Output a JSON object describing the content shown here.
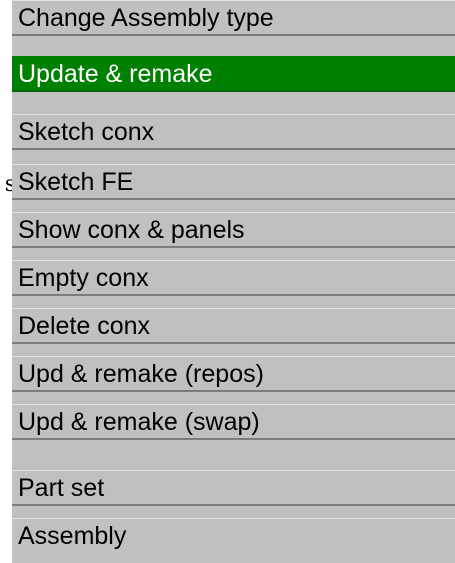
{
  "stray_text": "s",
  "menu": {
    "selected_index": 1,
    "selected_color": "#008000",
    "items": [
      {
        "label": "Change Assembly type"
      },
      {
        "label": "Update & remake"
      },
      {
        "label": "Sketch conx"
      },
      {
        "label": "Sketch FE"
      },
      {
        "label": "Show conx & panels"
      },
      {
        "label": "Empty conx"
      },
      {
        "label": "Delete conx"
      },
      {
        "label": "Upd & remake (repos)"
      },
      {
        "label": "Upd & remake (swap)"
      },
      {
        "label": "Part set"
      },
      {
        "label": "Assembly"
      }
    ]
  }
}
